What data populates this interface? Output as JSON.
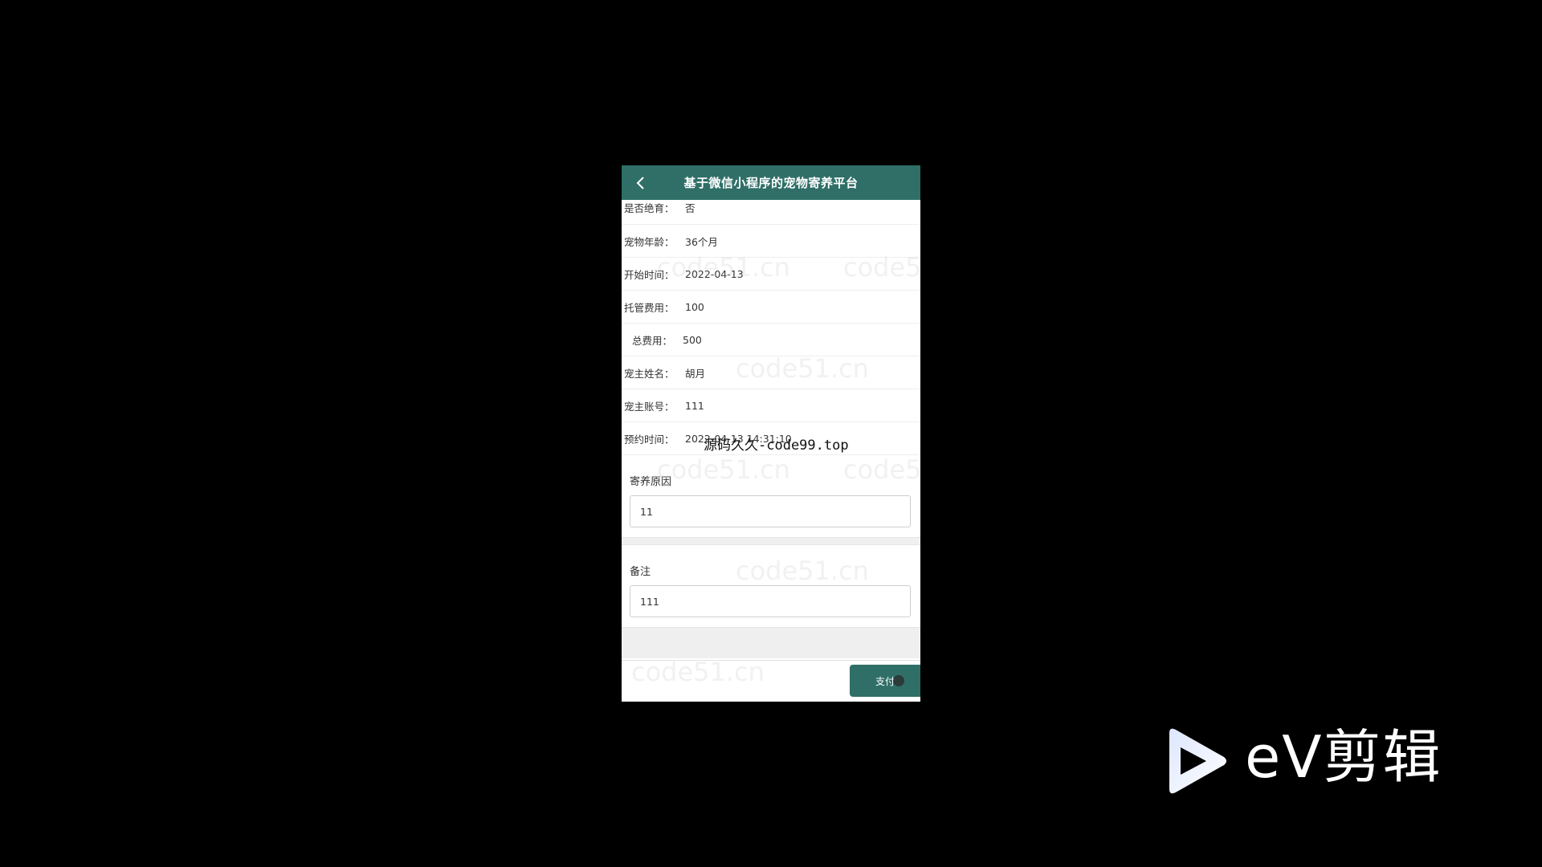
{
  "app": {
    "title": "基于微信小程序的宠物寄养平台"
  },
  "details": [
    {
      "label": "是否绝育：",
      "value": "否"
    },
    {
      "label": "宠物年龄：",
      "value": "36个月"
    },
    {
      "label": "开始时间：",
      "value": "2022-04-13"
    },
    {
      "label": "托管费用：",
      "value": "100"
    },
    {
      "label": "总费用：",
      "value": "500"
    },
    {
      "label": "宠主姓名：",
      "value": "胡月"
    },
    {
      "label": "宠主账号：",
      "value": "111"
    },
    {
      "label": "预约时间：",
      "value": "2022-04-13 14:31:10"
    }
  ],
  "form": {
    "reason_label": "寄养原因",
    "reason_value": "11",
    "remark_label": "备注",
    "remark_value": "111"
  },
  "footer": {
    "pay_label": "支付"
  },
  "overlay": {
    "caption": "源码久久-code99.top",
    "watermark": "code51.cn"
  },
  "brand": {
    "logo_text": "eV剪辑"
  },
  "colors": {
    "accent": "#2f6f67",
    "background": "#000000"
  },
  "icons": {
    "back": "chevron-left-icon",
    "logo": "play-triangle-icon"
  }
}
